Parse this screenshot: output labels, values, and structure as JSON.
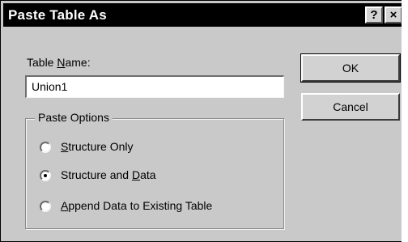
{
  "window": {
    "title": "Paste Table As",
    "help_label": "?",
    "close_label": "×"
  },
  "table_name": {
    "label_prefix": "Table ",
    "label_accel": "N",
    "label_suffix": "ame:",
    "value": "Union1"
  },
  "buttons": {
    "ok": "OK",
    "cancel": "Cancel"
  },
  "paste_options": {
    "group_label": "Paste Options",
    "selected": "Structure and Data",
    "options": [
      {
        "accel": "S",
        "rest": "tructure Only",
        "pre": "",
        "selected": false
      },
      {
        "pre": "Structure and ",
        "accel": "D",
        "rest": "ata",
        "selected": true
      },
      {
        "accel": "A",
        "rest": "ppend Data to Existing Table",
        "pre": "",
        "selected": false
      }
    ]
  }
}
